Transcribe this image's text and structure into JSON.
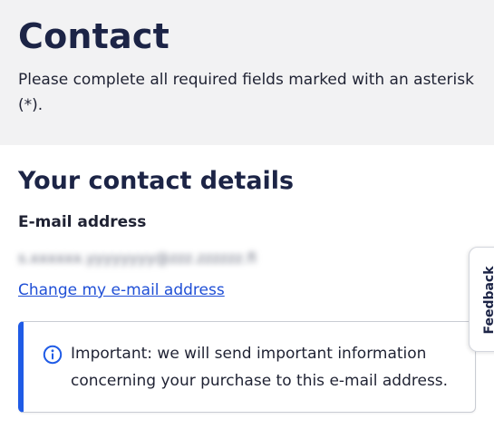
{
  "header": {
    "title": "Contact",
    "intro": "Please complete all required fields marked with an asterisk (*)."
  },
  "contact_details": {
    "section_title": "Your contact details",
    "email_label": "E-mail address",
    "email_value": "s.xxxxxx.yyyyyyyy@zzz.zzzzzz.fi",
    "change_link": "Change my e-mail address"
  },
  "notice": {
    "icon": "info-icon",
    "text": "Important: we will send important information concerning your purchase to this e-mail address.",
    "accent_color": "#1f5be6"
  },
  "feedback_tab": {
    "label": "Feedback"
  }
}
